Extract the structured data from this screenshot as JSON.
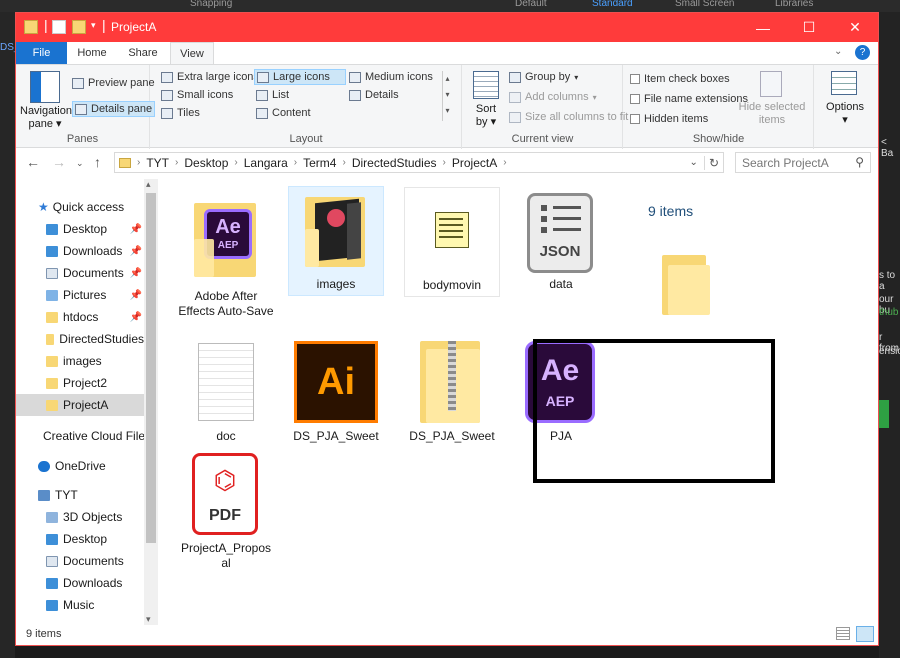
{
  "background": {
    "top_tabs": [
      "Snapping",
      "Default",
      "Standard",
      "Small Screen",
      "Libraries"
    ],
    "left_snippet": "DS_",
    "right_snippets": [
      "< Ba",
      "s to a",
      "our bu",
      "thub",
      "r from",
      "ensio"
    ]
  },
  "window": {
    "title": "ProjectA",
    "controls": {
      "minimize": "—",
      "maximize": "☐",
      "close": "✕"
    }
  },
  "ribbon_tabs": {
    "file": "File",
    "home": "Home",
    "share": "Share",
    "view": "View"
  },
  "ribbon": {
    "panes": {
      "label": "Panes",
      "navigation_pane": "Navigation pane",
      "preview_pane": "Preview pane",
      "details_pane": "Details pane"
    },
    "layout": {
      "label": "Layout",
      "items": {
        "extra_large": "Extra large icons",
        "large": "Large icons",
        "medium": "Medium icons",
        "small": "Small icons",
        "list": "List",
        "details": "Details",
        "tiles": "Tiles",
        "content": "Content"
      }
    },
    "current_view": {
      "label": "Current view",
      "sort_by": "Sort by",
      "group_by": "Group by",
      "add_columns": "Add columns",
      "size_columns": "Size all columns to fit"
    },
    "show_hide": {
      "label": "Show/hide",
      "item_checkboxes": "Item check boxes",
      "file_extensions": "File name extensions",
      "hidden_items": "Hidden items",
      "hide_selected": "Hide selected items"
    },
    "options": "Options"
  },
  "address": {
    "crumbs": [
      "TYT",
      "Desktop",
      "Langara",
      "Term4",
      "DirectedStudies",
      "ProjectA"
    ],
    "search_placeholder": "Search ProjectA"
  },
  "nav": {
    "quick_access": "Quick access",
    "quick_items": [
      {
        "label": "Desktop",
        "pinned": true
      },
      {
        "label": "Downloads",
        "pinned": true
      },
      {
        "label": "Documents",
        "pinned": true
      },
      {
        "label": "Pictures",
        "pinned": true
      },
      {
        "label": "htdocs",
        "pinned": true
      },
      {
        "label": "DirectedStudies",
        "pinned": false
      },
      {
        "label": "images",
        "pinned": false
      },
      {
        "label": "Project2",
        "pinned": false
      },
      {
        "label": "ProjectA",
        "pinned": false
      }
    ],
    "creative_cloud": "Creative Cloud Files",
    "onedrive": "OneDrive",
    "this_pc": "TYT",
    "pc_items": [
      "3D Objects",
      "Desktop",
      "Documents",
      "Downloads",
      "Music"
    ]
  },
  "content": {
    "items_count": "9 items",
    "files": [
      {
        "name": "Adobe After Effects Auto-Save",
        "type": "folder-ae"
      },
      {
        "name": "images",
        "type": "folder-images"
      },
      {
        "name": "bodymovin",
        "type": "script"
      },
      {
        "name": "data",
        "type": "json",
        "badge": "JSON"
      },
      {
        "name": "doc",
        "type": "document"
      },
      {
        "name": "DS_PJA_Sweet",
        "type": "ai",
        "badge": "Ai"
      },
      {
        "name": "DS_PJA_Sweet",
        "type": "zip"
      },
      {
        "name": "PJA",
        "type": "aep",
        "badge": "Ae",
        "sub": "AEP"
      },
      {
        "name": "ProjectA_Proposal",
        "type": "pdf",
        "badge": "PDF"
      }
    ],
    "ae_folder_badge": "Ae",
    "ae_folder_sub": "AEP"
  },
  "status": {
    "count": "9 items"
  },
  "colors": {
    "titlebar": "#ff3b3b",
    "file_tab": "#1a73d0",
    "folder": "#f8d775"
  }
}
